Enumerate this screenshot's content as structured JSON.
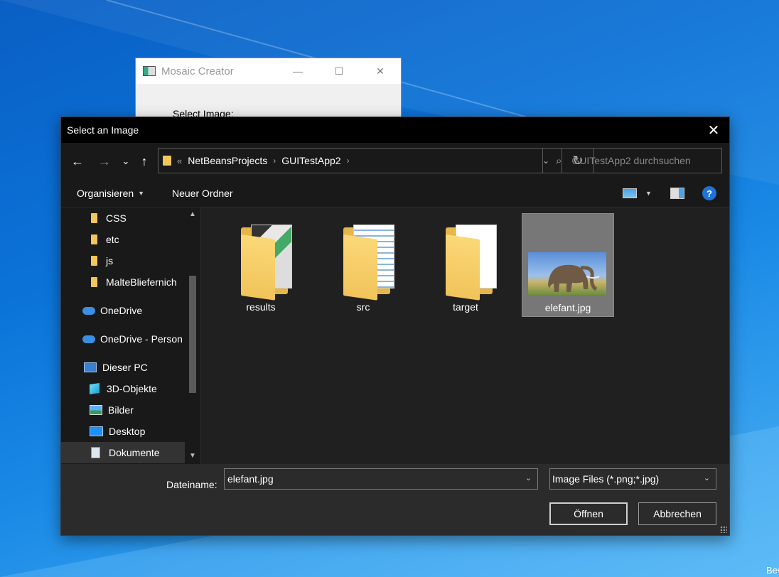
{
  "background_window": {
    "title": "Mosaic Creator",
    "label": "Select Image:",
    "controls": {
      "minimize": "—",
      "maximize": "☐",
      "close": "✕"
    }
  },
  "desktop": {
    "taskbar_hint": "Bev"
  },
  "dialog": {
    "title": "Select an Image",
    "close": "✕",
    "nav": {
      "back": "←",
      "forward": "→",
      "recent": "⌄",
      "up": "↑"
    },
    "address": {
      "prefix": "«",
      "path": [
        "NetBeansProjects",
        "GUITestApp2"
      ],
      "separator": "›",
      "dropdown": "⌄",
      "refresh": "↻"
    },
    "search": {
      "placeholder": "GUITestApp2 durchsuchen",
      "icon": "search-icon"
    },
    "toolbar": {
      "organize": "Organisieren",
      "new_folder": "Neuer Ordner",
      "help": "?"
    },
    "sidebar": {
      "items": [
        {
          "label": "CSS",
          "icon": "folder-icon"
        },
        {
          "label": "etc",
          "icon": "folder-icon"
        },
        {
          "label": "js",
          "icon": "folder-icon"
        },
        {
          "label": "MalteBliefernich",
          "icon": "folder-icon"
        },
        {
          "label": "OneDrive",
          "icon": "cloud-icon"
        },
        {
          "label": "OneDrive - Person",
          "icon": "cloud-icon"
        },
        {
          "label": "Dieser PC",
          "icon": "computer-icon"
        },
        {
          "label": "3D-Objekte",
          "icon": "cube-icon"
        },
        {
          "label": "Bilder",
          "icon": "pictures-icon"
        },
        {
          "label": "Desktop",
          "icon": "desktop-icon"
        },
        {
          "label": "Dokumente",
          "icon": "document-icon"
        }
      ],
      "selected": "Dokumente"
    },
    "files": [
      {
        "name": "results",
        "type": "folder"
      },
      {
        "name": "src",
        "type": "folder"
      },
      {
        "name": "target",
        "type": "folder"
      },
      {
        "name": "elefant.jpg",
        "type": "image",
        "selected": true
      }
    ],
    "footer": {
      "filename_label": "Dateiname:",
      "filename_value": "elefant.jpg",
      "filter_value": "Image Files (*.png;*.jpg)",
      "open_label": "Öffnen",
      "cancel_label": "Abbrechen"
    }
  },
  "colors": {
    "dialog_bg": "#191919",
    "content_bg": "#202020",
    "footer_bg": "#2b2b2b",
    "folder": "#f3c65a",
    "help_blue": "#1e73d6"
  }
}
